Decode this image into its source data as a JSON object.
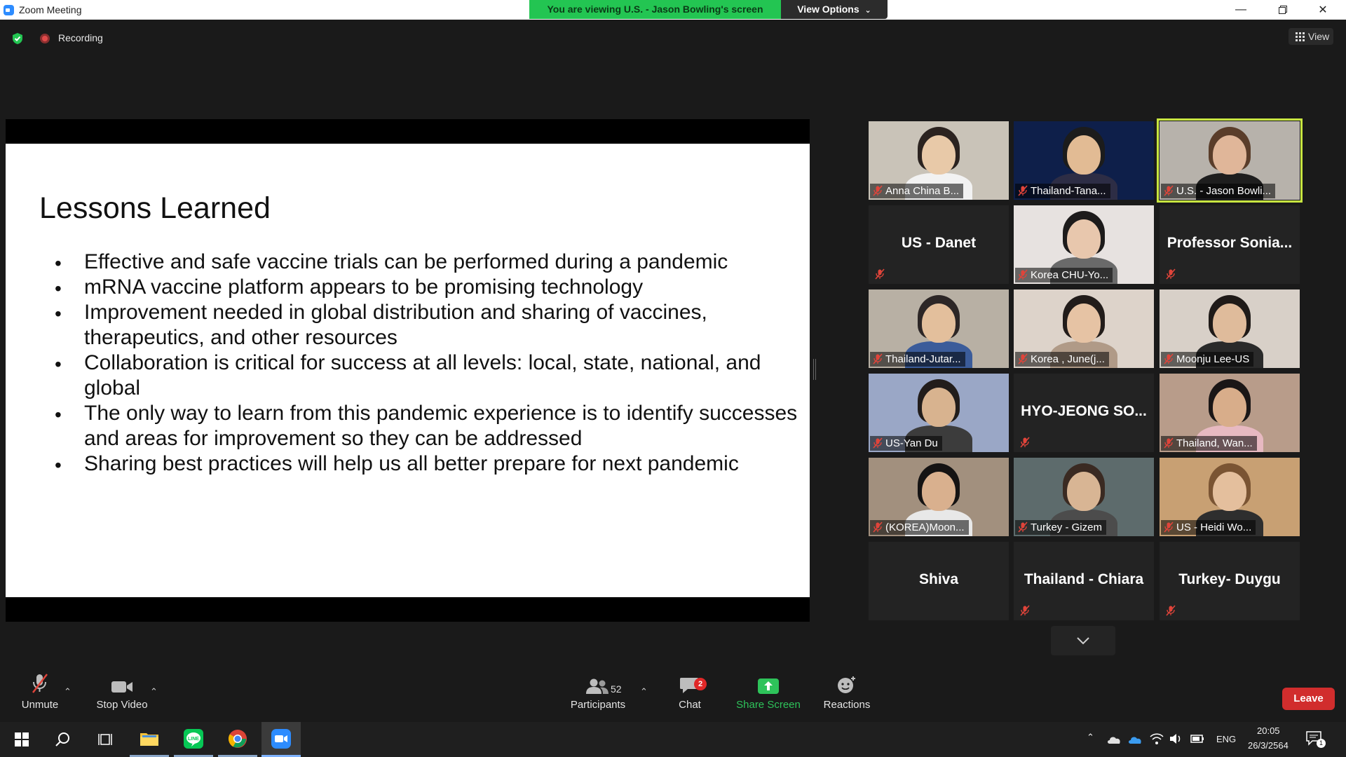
{
  "window": {
    "title": "Zoom Meeting",
    "viewing_banner": "You are viewing U.S. - Jason Bowling's screen",
    "view_options": "View Options"
  },
  "top_bar": {
    "recording": "Recording",
    "view": "View"
  },
  "slide": {
    "title": "Lessons Learned",
    "bullets": [
      "Effective and safe vaccine trials can be performed during a pandemic",
      "mRNA vaccine platform appears to be promising technology",
      "Improvement needed in global distribution and sharing of vaccines, therapeutics, and other resources",
      "Collaboration is critical for success at all levels: local, state, national, and global",
      "The only way to learn from this pandemic experience is to identify successes and areas for improvement so they can be addressed",
      "Sharing best practices will help us all better prepare for next pandemic"
    ]
  },
  "gallery": {
    "tiles": [
      {
        "name": "Anna China B...",
        "video": true
      },
      {
        "name": "Thailand-Tana...",
        "video": true
      },
      {
        "name": "U.S. - Jason Bowli...",
        "video": true,
        "active": true
      },
      {
        "name": "US - Danet",
        "video": false
      },
      {
        "name": "Korea CHU-Yo...",
        "video": true
      },
      {
        "name": "Professor Sonia...",
        "video": false
      },
      {
        "name": "Thailand-Jutar...",
        "video": true
      },
      {
        "name": "Korea , June(j...",
        "video": true
      },
      {
        "name": "Moonju Lee-US",
        "video": true
      },
      {
        "name": "US-Yan Du",
        "video": true
      },
      {
        "name": "HYO-JEONG SO...",
        "video": false
      },
      {
        "name": "Thailand, Wan...",
        "video": true
      },
      {
        "name": "(KOREA)Moon...",
        "video": true
      },
      {
        "name": "Turkey - Gizem",
        "video": true
      },
      {
        "name": "US - Heidi Wo...",
        "video": true
      },
      {
        "name": "Shiva",
        "video": false,
        "muted": false
      },
      {
        "name": "Thailand - Chiara",
        "video": false
      },
      {
        "name": "Turkey- Duygu",
        "video": false
      }
    ]
  },
  "toolbar": {
    "unmute": "Unmute",
    "stop_video": "Stop Video",
    "participants": "Participants",
    "participants_count": "52",
    "chat": "Chat",
    "chat_badge": "2",
    "share_screen": "Share Screen",
    "reactions": "Reactions",
    "leave": "Leave"
  },
  "taskbar": {
    "lang": "ENG",
    "time": "20:05",
    "date": "26/3/2564",
    "notification_count": "1"
  },
  "colors": {
    "banner_green": "#23c552",
    "active_speaker": "#c8e640",
    "leave_red": "#d12d2d",
    "share_green": "#2ec35a",
    "mute_red": "#e0443a"
  }
}
